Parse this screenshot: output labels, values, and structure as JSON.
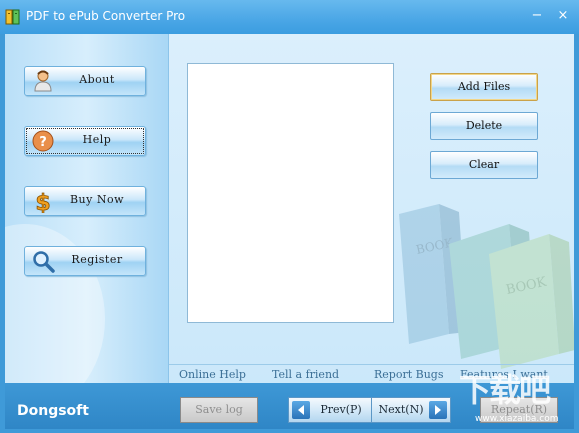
{
  "window": {
    "title": "PDF to ePub Converter Pro",
    "minimize_glyph": "−",
    "close_glyph": "×"
  },
  "sidebar": {
    "buttons": [
      {
        "label": "About",
        "icon": "person-icon"
      },
      {
        "label": "Help",
        "icon": "help-icon"
      },
      {
        "label": "Buy Now",
        "icon": "dollar-icon"
      },
      {
        "label": "Register",
        "icon": "magnifier-icon"
      }
    ]
  },
  "actions": {
    "add_files": "Add Files",
    "delete": "Delete",
    "clear": "Clear"
  },
  "links": {
    "online_help": "Online Help",
    "tell_friend": "Tell a friend",
    "report_bugs": "Report Bugs",
    "features": "Features I want"
  },
  "bottom": {
    "brand": "Dongsoft",
    "save_log": "Save log",
    "prev": "Prev(P)",
    "next": "Next(N)",
    "repeat": "Repeat(R)"
  },
  "watermark": {
    "text": "下载吧",
    "url": "www.xiazaiba.com"
  },
  "colors": {
    "titlebar": "#4aa6e6",
    "frame": "#3f9ad8",
    "content_bg": "#d7eefc"
  }
}
